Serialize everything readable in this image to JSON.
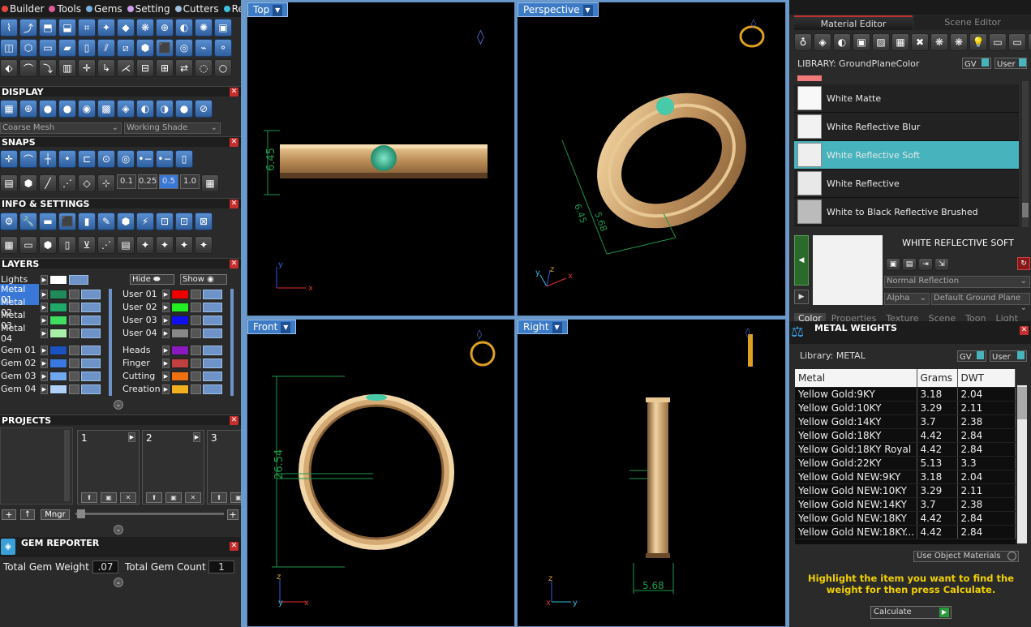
{
  "menubar": {
    "items": [
      {
        "label": "Builder",
        "color": "#e04a3a"
      },
      {
        "label": "Tools",
        "color": "#e05a9a"
      },
      {
        "label": "Gems",
        "color": "#7ab0e0"
      },
      {
        "label": "Setting",
        "color": "#d0a0f0"
      },
      {
        "label": "Cutters",
        "color": "#a0c0e0"
      },
      {
        "label": "Render",
        "color": "#40c0e0"
      }
    ]
  },
  "display": {
    "title": "DISPLAY",
    "mesh_select": "Coarse Mesh",
    "shade_select": "Working Shade"
  },
  "snaps": {
    "title": "SNAPS",
    "values": [
      "0.1",
      "0.25",
      "0.5",
      "1.0"
    ]
  },
  "info": {
    "title": "INFO & SETTINGS"
  },
  "layers": {
    "title": "LAYERS",
    "lights_label": "Lights",
    "hide_label": "Hide",
    "show_label": "Show",
    "left_col": [
      {
        "name": "Metal 01",
        "color": "#1f8a5a",
        "selected": true
      },
      {
        "name": "Metal 02",
        "color": "#1faa6a"
      },
      {
        "name": "Metal 03",
        "color": "#40dd60"
      },
      {
        "name": "Metal 04",
        "color": "#a8f0a8"
      },
      {
        "name": "Gem 01",
        "color": "#1a52c0"
      },
      {
        "name": "Gem 02",
        "color": "#3a7ae0"
      },
      {
        "name": "Gem 03",
        "color": "#70a8f0"
      },
      {
        "name": "Gem 04",
        "color": "#b0d0f8"
      }
    ],
    "right_col": [
      {
        "name": "User 01",
        "color": "#ee0000"
      },
      {
        "name": "User 02",
        "color": "#22ee22"
      },
      {
        "name": "User 03",
        "color": "#1010ee"
      },
      {
        "name": "User 04",
        "color": "#888888"
      },
      {
        "name": "Heads",
        "color": "#8a1ac0"
      },
      {
        "name": "Finger",
        "color": "#c04040"
      },
      {
        "name": "Cutting",
        "color": "#ee7010"
      },
      {
        "name": "Creation",
        "color": "#f0b020"
      }
    ]
  },
  "projects": {
    "title": "PROJECTS",
    "slots": [
      "1",
      "2",
      "3"
    ],
    "mngr_label": "Mngr"
  },
  "gem_reporter": {
    "title": "GEM REPORTER",
    "weight_label": "Total Gem Weight",
    "weight_value": ".07",
    "count_label": "Total Gem Count",
    "count_value": "1"
  },
  "viewports": {
    "top": {
      "label": "Top",
      "dim": "6.45"
    },
    "perspective": {
      "label": "Perspective",
      "dim1": "6.45",
      "dim2": "5.68"
    },
    "front": {
      "label": "Front",
      "dim": "26.54"
    },
    "right": {
      "label": "Right",
      "dim": "5.68"
    }
  },
  "material_editor": {
    "tab_material": "Material Editor",
    "tab_scene": "Scene Editor",
    "library_label": "LIBRARY: GroundPlaneColor",
    "gv": "GV",
    "user": "User",
    "materials": [
      {
        "name": "White Matte",
        "shade": "#f8f8f8"
      },
      {
        "name": "White Reflective Blur",
        "shade": "#f2f2f2"
      },
      {
        "name": "White Reflective Soft",
        "shade": "#eeeeee",
        "selected": true
      },
      {
        "name": "White Reflective",
        "shade": "#e8e8e8"
      },
      {
        "name": "White to Black Reflective Brushed",
        "shade": "#bbbbbb"
      }
    ],
    "preview_title": "WHITE REFLECTIVE SOFT",
    "reflection_select": "Normal Reflection",
    "alpha_select": "Alpha",
    "ground_select": "Default Ground Plane",
    "bottom_tabs": [
      "Color",
      "Properties",
      "Texture",
      "Scene",
      "Toon",
      "Light"
    ]
  },
  "metal_weights": {
    "title": "METAL WEIGHTS",
    "library_label": "Library: METAL",
    "gv": "GV",
    "user": "User",
    "columns": [
      "Metal",
      "Grams",
      "DWT"
    ],
    "rows": [
      [
        "Yellow Gold:9KY",
        "3.18",
        "2.04"
      ],
      [
        "Yellow Gold:10KY",
        "3.29",
        "2.11"
      ],
      [
        "Yellow Gold:14KY",
        "3.7",
        "2.38"
      ],
      [
        "Yellow Gold:18KY",
        "4.42",
        "2.84"
      ],
      [
        "Yellow Gold:18KY Royal",
        "4.42",
        "2.84"
      ],
      [
        "Yellow Gold:22KY",
        "5.13",
        "3.3"
      ],
      [
        "Yellow Gold NEW:9KY",
        "3.18",
        "2.04"
      ],
      [
        "Yellow Gold NEW:10KY",
        "3.29",
        "2.11"
      ],
      [
        "Yellow Gold NEW:14KY",
        "3.7",
        "2.38"
      ],
      [
        "Yellow Gold NEW:18KY",
        "4.42",
        "2.84"
      ],
      [
        "Yellow Gold NEW:18KY...",
        "4.42",
        "2.84"
      ]
    ],
    "use_object_label": "Use Object Materials",
    "hint": "Highlight the item you want to find the weight for then press Calculate.",
    "calculate_label": "Calculate"
  }
}
